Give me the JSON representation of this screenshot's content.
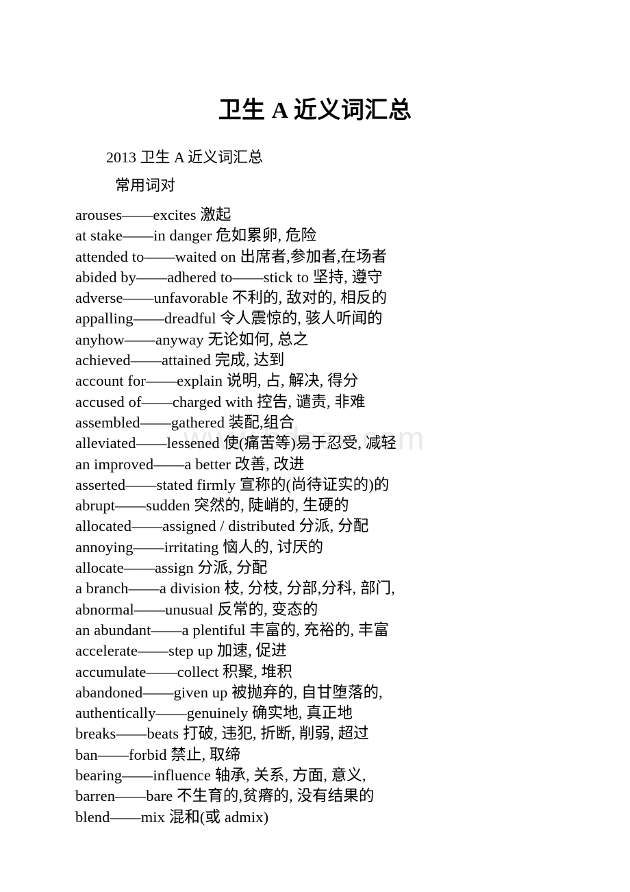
{
  "document": {
    "title": "卫生 A 近义词汇总",
    "intro_line_1": "2013 卫生 A 近义词汇总",
    "intro_line_2": "常用词对",
    "watermark": "www.bdocx.com",
    "background_color": "#ffffff",
    "text_color": "#000000",
    "watermark_color": "#e9e9ee",
    "word_pairs": [
      "arouses——excites 激起",
      "at stake——in danger 危如累卵, 危险",
      "attended to——waited on 出席者,参加者,在场者",
      "abided by——adhered to——stick to 坚持, 遵守",
      "adverse——unfavorable 不利的, 敌对的, 相反的",
      "appalling——dreadful 令人震惊的, 骇人听闻的",
      "anyhow——anyway 无论如何, 总之",
      "achieved——attained 完成, 达到",
      "account for——explain 说明, 占, 解决, 得分",
      "accused of——charged with 控告, 谴责, 非难",
      "assembled——gathered 装配,组合",
      "alleviated——lessened 使(痛苦等)易于忍受, 减轻",
      "an improved——a better 改善, 改进",
      "asserted——stated firmly 宣称的(尚待证实的)的",
      "abrupt——sudden 突然的, 陡峭的, 生硬的",
      "allocated——assigned / distributed 分派, 分配",
      "annoying——irritating 恼人的, 讨厌的",
      "allocate——assign 分派, 分配",
      "a branch——a division 枝, 分枝, 分部,分科, 部门,",
      "abnormal——unusual 反常的, 变态的",
      "an abundant——a plentiful 丰富的, 充裕的, 丰富",
      "accelerate——step up 加速, 促进",
      "accumulate——collect 积聚, 堆积",
      "abandoned——given up 被抛弃的, 自甘堕落的,",
      "authentically——genuinely 确实地, 真正地",
      "breaks——beats 打破, 违犯, 折断, 削弱, 超过",
      "ban——forbid 禁止, 取缔",
      "bearing——influence 轴承, 关系, 方面, 意义,",
      "barren——bare 不生育的,贫瘠的, 没有结果的",
      "blend——mix 混和(或 admix)"
    ]
  }
}
